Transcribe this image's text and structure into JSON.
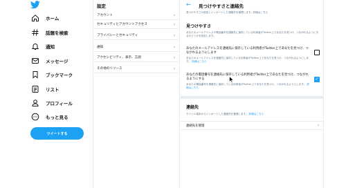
{
  "colors": {
    "accent": "#1da1f2",
    "border": "#e6ecf0",
    "text": "#14171a",
    "muted": "#657786"
  },
  "nav": {
    "logo_icon": "twitter-bird-icon",
    "items": [
      {
        "icon": "home-icon",
        "label": "ホーム"
      },
      {
        "icon": "hashtag-icon",
        "label": "話題を検索"
      },
      {
        "icon": "bell-icon",
        "label": "通知"
      },
      {
        "icon": "envelope-icon",
        "label": "メッセージ"
      },
      {
        "icon": "bookmark-icon",
        "label": "ブックマーク"
      },
      {
        "icon": "list-icon",
        "label": "リスト"
      },
      {
        "icon": "person-icon",
        "label": "プロフィール"
      },
      {
        "icon": "more-icon",
        "label": "もっと見る"
      }
    ],
    "tweet_button": "ツイートする"
  },
  "settings": {
    "title": "設定",
    "items": [
      "アカウント",
      "セキュリティとアカウントアクセス",
      "プライバシーとセキュリティ",
      "通知",
      "アクセシビリティ、表示、言語",
      "その他のリソース"
    ]
  },
  "detail": {
    "title": "見つけやすさと連絡先",
    "intro": "見つけやすさの設定とインポートした連絡先を管理します。詳細はこちら",
    "discoverability_heading": "見つけやすさ",
    "discoverability_desc": "あなたのメールアドレスや電話番号を連絡先に保存している利用者がTwitter上であなたを見つけ、つながれるようにするかどうかを設定します。",
    "options": [
      {
        "title": "あなたのメールアドレスを連絡先に保存している利用者がTwitter上であなたを見つけ、つながれるようにします",
        "sub": "あなたのメールアドレスを連絡先に保存している利用者がTwitter上であなたを見つけ、つながれるようにします。",
        "link": "詳細はこちら",
        "checked": false
      },
      {
        "title": "あなたの電話番号を連絡先に保存している利用者がTwitter上であなたを見つけ、つながれるようにする",
        "sub": "あなたの電話番号を連絡先に保存している利用者がTwitter上であなたを見つけ、つながれるようにします。",
        "link": "詳細はこちら",
        "checked": true
      }
    ],
    "contacts_heading": "連絡先",
    "contacts_desc": "モバイル端末からインポートした連絡先を管理します。",
    "contacts_link": "詳細はこちら",
    "manage_label": "連絡先を管理"
  }
}
